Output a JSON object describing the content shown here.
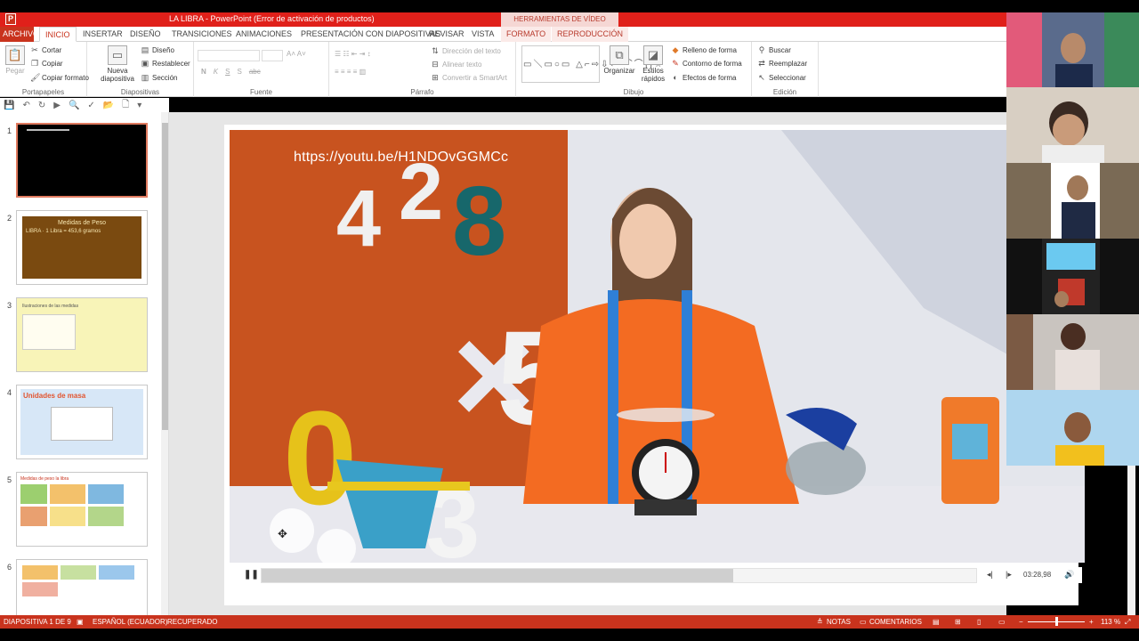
{
  "app": {
    "icon_letter": "P",
    "title": "LA LIBRA  -  PowerPoint (Error de activación de productos)",
    "context_tab_group": "HERRAMIENTAS DE VÍDEO"
  },
  "tabs": [
    {
      "label": "ARCHIVO"
    },
    {
      "label": "INICIO"
    },
    {
      "label": "INSERTAR"
    },
    {
      "label": "DISEÑO"
    },
    {
      "label": "TRANSICIONES"
    },
    {
      "label": "ANIMACIONES"
    },
    {
      "label": "PRESENTACIÓN CON DIAPOSITIVAS"
    },
    {
      "label": "REVISAR"
    },
    {
      "label": "VISTA"
    },
    {
      "label": "FORMATO"
    },
    {
      "label": "REPRODUCCIÓN"
    }
  ],
  "ribbon": {
    "portapapeles": {
      "label": "Portapapeles",
      "pegar": "Pegar",
      "cortar": "Cortar",
      "copiar": "Copiar",
      "copiar_formato": "Copiar formato"
    },
    "diapositivas": {
      "label": "Diapositivas",
      "nueva": "Nueva",
      "nueva2": "diapositiva",
      "diseno": "Diseño",
      "restablecer": "Restablecer",
      "seccion": "Sección"
    },
    "fuente": {
      "label": "Fuente",
      "bold": "N",
      "italic": "K",
      "underline": "S",
      "strike": "S",
      "abc": "abc"
    },
    "parrafo": {
      "label": "Párrafo",
      "direccion": "Dirección del texto",
      "alinear": "Alinear texto",
      "smartart": "Convertir a SmartArt"
    },
    "dibujo": {
      "label": "Dibujo",
      "organizar": "Organizar",
      "estilos": "Estilos",
      "estilos2": "rápidos",
      "relleno": "Relleno de forma",
      "contorno": "Contorno de forma",
      "efectos": "Efectos de forma"
    },
    "edicion": {
      "label": "Edición",
      "buscar": "Buscar",
      "reemplazar": "Reemplazar",
      "seleccionar": "Seleccionar"
    }
  },
  "slides": [
    {
      "num": "1",
      "selected": true
    },
    {
      "num": "2",
      "title": "Medidas de Peso",
      "text": "LIBRA · 1 Libra = 453,6 gramos"
    },
    {
      "num": "3",
      "title": "Ilustraciones de las medidas"
    },
    {
      "num": "4",
      "title": "Unidades de masa"
    },
    {
      "num": "5",
      "title": "Medidas de peso la libra"
    },
    {
      "num": "6"
    }
  ],
  "video": {
    "url_text": "https://youtu.be/H1NDOvGGMCc",
    "time": "03:28,98",
    "progress": 0.66
  },
  "status": {
    "slide": "DIAPOSITIVA 1 DE 9",
    "lang": "ESPAÑOL (ECUADOR)",
    "recovered": "RECUPERADO",
    "notas": "NOTAS",
    "comentarios": "COMENTARIOS",
    "zoom": "113 %"
  }
}
